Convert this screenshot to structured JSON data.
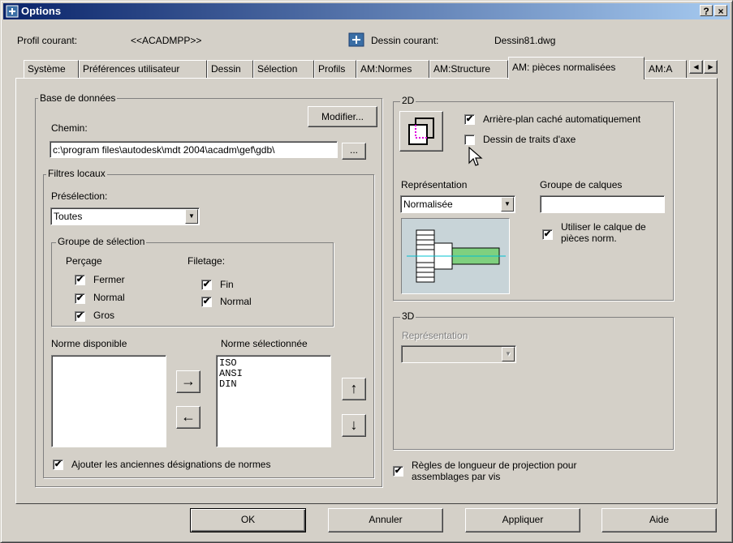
{
  "window": {
    "title": "Options",
    "help_btn": "?",
    "close_btn": "×"
  },
  "header": {
    "profil_label": "Profil courant:",
    "profil_value": "<<ACADMPP>>",
    "dessin_label": "Dessin courant:",
    "dessin_value": "Dessin81.dwg"
  },
  "tabs": [
    {
      "label": "Système"
    },
    {
      "label": "Préférences utilisateur"
    },
    {
      "label": "Dessin"
    },
    {
      "label": "Sélection"
    },
    {
      "label": "Profils"
    },
    {
      "label": "AM:Normes"
    },
    {
      "label": "AM:Structure"
    },
    {
      "label": "AM: pièces normalisées",
      "active": true
    },
    {
      "label": "AM:A"
    }
  ],
  "tab_scroll": {
    "left": "◀",
    "right": "▶"
  },
  "base": {
    "group_label": "Base de données",
    "modifier_btn": "Modifier...",
    "chemin_label": "Chemin:",
    "chemin_value": "c:\\program files\\autodesk\\mdt 2004\\acadm\\gef\\gdb\\",
    "browse_btn": "...",
    "filtres": {
      "group_label": "Filtres locaux",
      "preselection_label": "Présélection:",
      "preselection_value": "Toutes",
      "groupe_selection": {
        "group_label": "Groupe de sélection",
        "percage_label": "Perçage",
        "filetage_label": "Filetage:",
        "percage": [
          {
            "label": "Fermer",
            "checked": true
          },
          {
            "label": "Normal",
            "checked": true
          },
          {
            "label": "Gros",
            "checked": true
          }
        ],
        "filetage": [
          {
            "label": "Fin",
            "checked": true
          },
          {
            "label": "Normal",
            "checked": true
          }
        ]
      },
      "norme_disponible_label": "Norme disponible",
      "norme_selectionnee_label": "Norme sélectionnée",
      "norme_disponible": [],
      "norme_selectionnee": [
        "ISO",
        "ANSI",
        "DIN"
      ],
      "arrow_right": "→",
      "arrow_left": "←",
      "arrow_up": "↑",
      "arrow_down": "↓",
      "anciennes_label": "Ajouter les anciennes désignations de normes",
      "anciennes_checked": true
    }
  },
  "twod": {
    "group_label": "2D",
    "arriere_plan_label": "Arrière-plan caché automatiquement",
    "arriere_plan_checked": true,
    "traits_axe_label": "Dessin de traits d'axe",
    "traits_axe_checked": false,
    "representation_label": "Représentation",
    "representation_value": "Normalisée",
    "groupe_calques_label": "Groupe de calques",
    "groupe_calques_value": "",
    "utiliser_calque_label_1": "Utiliser le calque de",
    "utiliser_calque_label_2": "pièces norm.",
    "utiliser_calque_checked": true
  },
  "threed": {
    "group_label": "3D",
    "representation_label": "Représentation",
    "representation_value": ""
  },
  "regles": {
    "label_1": "Règles de longueur de projection pour",
    "label_2": "assemblages par vis",
    "checked": true
  },
  "footer": {
    "ok": "OK",
    "annuler": "Annuler",
    "appliquer": "Appliquer",
    "aide": "Aide"
  },
  "colors": {
    "face": "#d4d0c8",
    "title_start": "#0a246a",
    "title_end": "#a6caf0",
    "preview_bg": "#c8d4d8",
    "bolt_green": "#7fd07f",
    "axis_cyan": "#00c0d0",
    "magenta": "#e000e0"
  }
}
